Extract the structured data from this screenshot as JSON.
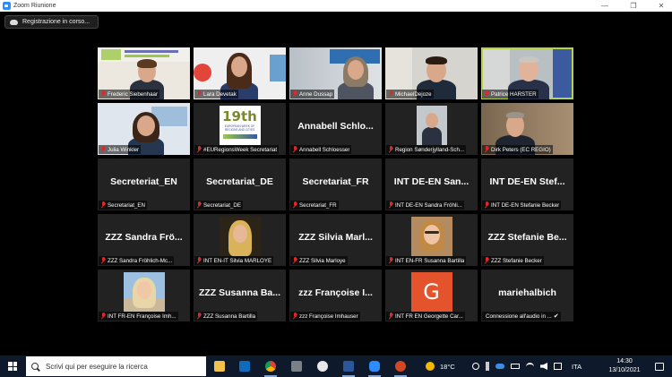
{
  "window": {
    "title": "Zoom Riunione",
    "controls": [
      "—",
      "❐",
      "✕"
    ]
  },
  "recording": {
    "label": "Registrazione in corso..."
  },
  "tiles": [
    {
      "name": "Frederic Siebenhaar",
      "muted": true
    },
    {
      "name": "Lara Devetak",
      "muted": true
    },
    {
      "name": "Anne Dussap",
      "muted": true
    },
    {
      "name": "MichaelDejoze",
      "muted": true
    },
    {
      "name": "Patrice HARSTER",
      "muted": true,
      "active": true
    },
    {
      "name": "Julia Winkler",
      "muted": true
    },
    {
      "name": "#EURegionsWeek Secretariat",
      "muted": true,
      "logo_text": "19th",
      "logo_sub": "EUROPEAN WEEK OF REGIONS AND CITIES"
    },
    {
      "name": "Annabell Schloesser",
      "muted": true,
      "big": "Annabell Schlo..."
    },
    {
      "name": "Region Sønderjylland-Sch...",
      "muted": true
    },
    {
      "name": "Dirk Peters (EC REGIO)",
      "muted": true
    },
    {
      "name": "Secretariat_EN",
      "muted": true,
      "big": "Secreteriat_EN"
    },
    {
      "name": "Secretariat_DE",
      "muted": true,
      "big": "Secretariat_DE"
    },
    {
      "name": "Secretariat_FR",
      "muted": true,
      "big": "Secretariat_FR"
    },
    {
      "name": "INT DE-EN  Sandra Fröhli...",
      "muted": true,
      "big": "INT DE-EN   San..."
    },
    {
      "name": "INT DE-EN Stefanie Becker",
      "muted": true,
      "big": "INT DE-EN  Stef..."
    },
    {
      "name": "ZZZ Sandra Fröhlich-Mc...",
      "muted": true,
      "big": "ZZZ Sandra Frö..."
    },
    {
      "name": "INT EN-IT Silvia MARLOYE",
      "muted": true
    },
    {
      "name": "ZZZ  Silvia Marloye",
      "muted": true,
      "big": "ZZZ  Silvia Marl..."
    },
    {
      "name": "INT EN-FR Susanna Bartilla",
      "muted": true
    },
    {
      "name": "ZZZ Stefanie Becker",
      "muted": true,
      "big": "ZZZ  Stefanie Be..."
    },
    {
      "name": "INT FR-EN Françoise Imh...",
      "muted": true
    },
    {
      "name": "ZZZ Susanna Bartilla",
      "muted": true,
      "big": "ZZZ  Susanna Ba..."
    },
    {
      "name": "zzz Françoise Imhauser",
      "muted": true,
      "big": "zzz  Françoise I..."
    },
    {
      "name": "INT FR EN Georgette Car...",
      "muted": true,
      "avatar_letter": "G"
    },
    {
      "name": "Connessione all'audio in ...",
      "muted": false,
      "big": "mariehalbich",
      "check": "✔"
    }
  ],
  "taskbar": {
    "search_placeholder": "Scrivi qui per eseguire la ricerca",
    "weather": "18°C",
    "language": "ITA",
    "time": "14:30",
    "date": "13/10/2021"
  },
  "colors": {
    "active_speaker": "#b7d34a",
    "muted_icon": "#e02828",
    "tile_bg": "#222222",
    "taskbar_bg": "#0e1a2b"
  }
}
